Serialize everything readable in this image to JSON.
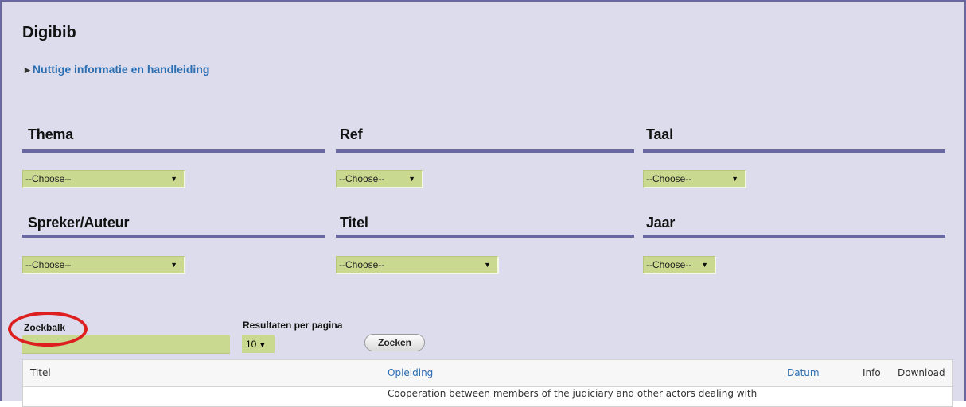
{
  "app": {
    "title": "Digibib",
    "info_link": "Nuttige informatie en handleiding"
  },
  "filters": [
    {
      "label": "Thema",
      "value": "--Choose--"
    },
    {
      "label": "Ref",
      "value": "--Choose--"
    },
    {
      "label": "Taal",
      "value": "--Choose--"
    },
    {
      "label": "Spreker/Auteur",
      "value": "--Choose--"
    },
    {
      "label": "Titel",
      "value": "--Choose--"
    },
    {
      "label": "Jaar",
      "value": "--Choose--"
    }
  ],
  "search": {
    "label": "Zoekbalk",
    "value": "",
    "results_per_page_label": "Resultaten per pagina",
    "results_per_page_value": "10",
    "button_label": "Zoeken"
  },
  "annotation": {
    "color": "#dd1f1f"
  },
  "table": {
    "columns": [
      "Titel",
      "Opleiding",
      "Datum",
      "Info",
      "Download"
    ],
    "rows": [
      [
        "",
        "Cooperation between members of the judiciary and other actors dealing with",
        "",
        "",
        ""
      ]
    ]
  },
  "icons": [
    "triangle-right-icon",
    "chevron-down-icon"
  ],
  "colors": {
    "accent": "#6a68a0",
    "select_bg": "#c9d98f",
    "link": "#2a6db0",
    "page_bg": "#dcdcec"
  }
}
